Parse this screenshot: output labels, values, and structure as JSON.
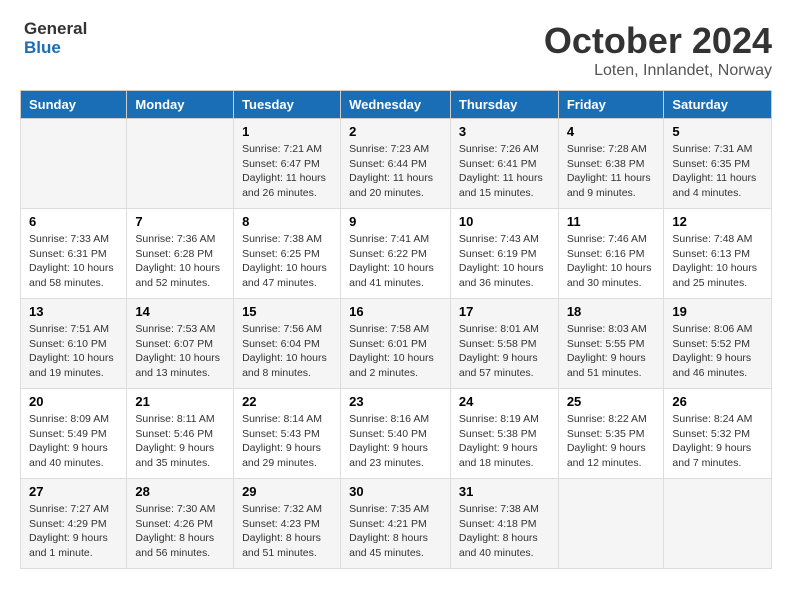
{
  "logo": {
    "line1": "General",
    "line2": "Blue"
  },
  "title": "October 2024",
  "location": "Loten, Innlandet, Norway",
  "weekdays": [
    "Sunday",
    "Monday",
    "Tuesday",
    "Wednesday",
    "Thursday",
    "Friday",
    "Saturday"
  ],
  "weeks": [
    [
      {
        "day": "",
        "info": ""
      },
      {
        "day": "",
        "info": ""
      },
      {
        "day": "1",
        "info": "Sunrise: 7:21 AM\nSunset: 6:47 PM\nDaylight: 11 hours and 26 minutes."
      },
      {
        "day": "2",
        "info": "Sunrise: 7:23 AM\nSunset: 6:44 PM\nDaylight: 11 hours and 20 minutes."
      },
      {
        "day": "3",
        "info": "Sunrise: 7:26 AM\nSunset: 6:41 PM\nDaylight: 11 hours and 15 minutes."
      },
      {
        "day": "4",
        "info": "Sunrise: 7:28 AM\nSunset: 6:38 PM\nDaylight: 11 hours and 9 minutes."
      },
      {
        "day": "5",
        "info": "Sunrise: 7:31 AM\nSunset: 6:35 PM\nDaylight: 11 hours and 4 minutes."
      }
    ],
    [
      {
        "day": "6",
        "info": "Sunrise: 7:33 AM\nSunset: 6:31 PM\nDaylight: 10 hours and 58 minutes."
      },
      {
        "day": "7",
        "info": "Sunrise: 7:36 AM\nSunset: 6:28 PM\nDaylight: 10 hours and 52 minutes."
      },
      {
        "day": "8",
        "info": "Sunrise: 7:38 AM\nSunset: 6:25 PM\nDaylight: 10 hours and 47 minutes."
      },
      {
        "day": "9",
        "info": "Sunrise: 7:41 AM\nSunset: 6:22 PM\nDaylight: 10 hours and 41 minutes."
      },
      {
        "day": "10",
        "info": "Sunrise: 7:43 AM\nSunset: 6:19 PM\nDaylight: 10 hours and 36 minutes."
      },
      {
        "day": "11",
        "info": "Sunrise: 7:46 AM\nSunset: 6:16 PM\nDaylight: 10 hours and 30 minutes."
      },
      {
        "day": "12",
        "info": "Sunrise: 7:48 AM\nSunset: 6:13 PM\nDaylight: 10 hours and 25 minutes."
      }
    ],
    [
      {
        "day": "13",
        "info": "Sunrise: 7:51 AM\nSunset: 6:10 PM\nDaylight: 10 hours and 19 minutes."
      },
      {
        "day": "14",
        "info": "Sunrise: 7:53 AM\nSunset: 6:07 PM\nDaylight: 10 hours and 13 minutes."
      },
      {
        "day": "15",
        "info": "Sunrise: 7:56 AM\nSunset: 6:04 PM\nDaylight: 10 hours and 8 minutes."
      },
      {
        "day": "16",
        "info": "Sunrise: 7:58 AM\nSunset: 6:01 PM\nDaylight: 10 hours and 2 minutes."
      },
      {
        "day": "17",
        "info": "Sunrise: 8:01 AM\nSunset: 5:58 PM\nDaylight: 9 hours and 57 minutes."
      },
      {
        "day": "18",
        "info": "Sunrise: 8:03 AM\nSunset: 5:55 PM\nDaylight: 9 hours and 51 minutes."
      },
      {
        "day": "19",
        "info": "Sunrise: 8:06 AM\nSunset: 5:52 PM\nDaylight: 9 hours and 46 minutes."
      }
    ],
    [
      {
        "day": "20",
        "info": "Sunrise: 8:09 AM\nSunset: 5:49 PM\nDaylight: 9 hours and 40 minutes."
      },
      {
        "day": "21",
        "info": "Sunrise: 8:11 AM\nSunset: 5:46 PM\nDaylight: 9 hours and 35 minutes."
      },
      {
        "day": "22",
        "info": "Sunrise: 8:14 AM\nSunset: 5:43 PM\nDaylight: 9 hours and 29 minutes."
      },
      {
        "day": "23",
        "info": "Sunrise: 8:16 AM\nSunset: 5:40 PM\nDaylight: 9 hours and 23 minutes."
      },
      {
        "day": "24",
        "info": "Sunrise: 8:19 AM\nSunset: 5:38 PM\nDaylight: 9 hours and 18 minutes."
      },
      {
        "day": "25",
        "info": "Sunrise: 8:22 AM\nSunset: 5:35 PM\nDaylight: 9 hours and 12 minutes."
      },
      {
        "day": "26",
        "info": "Sunrise: 8:24 AM\nSunset: 5:32 PM\nDaylight: 9 hours and 7 minutes."
      }
    ],
    [
      {
        "day": "27",
        "info": "Sunrise: 7:27 AM\nSunset: 4:29 PM\nDaylight: 9 hours and 1 minute."
      },
      {
        "day": "28",
        "info": "Sunrise: 7:30 AM\nSunset: 4:26 PM\nDaylight: 8 hours and 56 minutes."
      },
      {
        "day": "29",
        "info": "Sunrise: 7:32 AM\nSunset: 4:23 PM\nDaylight: 8 hours and 51 minutes."
      },
      {
        "day": "30",
        "info": "Sunrise: 7:35 AM\nSunset: 4:21 PM\nDaylight: 8 hours and 45 minutes."
      },
      {
        "day": "31",
        "info": "Sunrise: 7:38 AM\nSunset: 4:18 PM\nDaylight: 8 hours and 40 minutes."
      },
      {
        "day": "",
        "info": ""
      },
      {
        "day": "",
        "info": ""
      }
    ]
  ]
}
